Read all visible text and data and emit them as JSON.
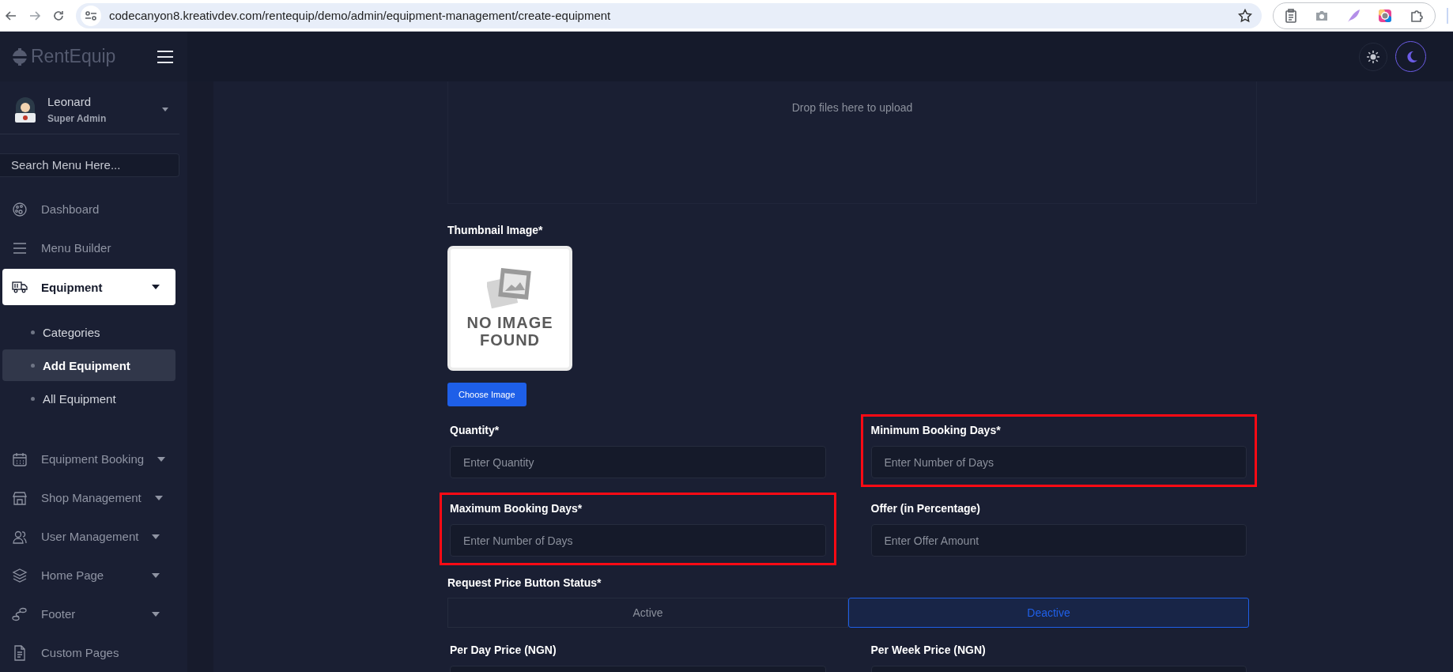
{
  "browser": {
    "url": "codecanyon8.kreativdev.com/rentequip/demo/admin/equipment-management/create-equipment"
  },
  "brand": {
    "name": "RentEquip"
  },
  "user": {
    "name": "Leonard",
    "role": "Super Admin"
  },
  "sidebar": {
    "search_placeholder": "Search Menu Here...",
    "items": [
      {
        "label": "Dashboard",
        "kind": "link",
        "selected": false
      },
      {
        "label": "Menu Builder",
        "kind": "link",
        "selected": false
      },
      {
        "label": "Equipment",
        "kind": "dropdown",
        "selected": true,
        "children": [
          {
            "label": "Categories",
            "selected": false
          },
          {
            "label": "Add Equipment",
            "selected": true
          },
          {
            "label": "All Equipment",
            "selected": false
          }
        ]
      },
      {
        "label": "Equipment Booking",
        "kind": "dropdown",
        "selected": false
      },
      {
        "label": "Shop Management",
        "kind": "dropdown",
        "selected": false
      },
      {
        "label": "User Management",
        "kind": "dropdown",
        "selected": false
      },
      {
        "label": "Home Page",
        "kind": "dropdown",
        "selected": false
      },
      {
        "label": "Footer",
        "kind": "dropdown",
        "selected": false
      },
      {
        "label": "Custom Pages",
        "kind": "link",
        "selected": false
      }
    ]
  },
  "theme_buttons": [
    {
      "kind": "sun",
      "selected": false
    },
    {
      "kind": "moon",
      "selected": true
    }
  ],
  "upload": {
    "text": "Drop files here to upload"
  },
  "thumbnail": {
    "label": "Thumbnail Image*",
    "image_text": "NO IMAGE FOUND",
    "button": "Choose Image"
  },
  "fields": [
    {
      "label": "Quantity*",
      "placeholder": "Enter Quantity",
      "highlighted": false
    },
    {
      "label": "Minimum Booking Days*",
      "placeholder": "Enter Number of Days",
      "highlighted": true
    },
    {
      "label": "Maximum Booking Days*",
      "placeholder": "Enter Number of Days",
      "highlighted": true
    },
    {
      "label": "Offer (in Percentage)",
      "placeholder": "Enter Offer Amount",
      "highlighted": false
    }
  ],
  "status_toggle": {
    "label": "Request Price Button Status*",
    "options": [
      {
        "label": "Active",
        "selected": false
      },
      {
        "label": "Deactive",
        "selected": true
      }
    ]
  },
  "price_fields": [
    {
      "label": "Per Day Price (NGN)"
    },
    {
      "label": "Per Week Price (NGN)"
    }
  ]
}
